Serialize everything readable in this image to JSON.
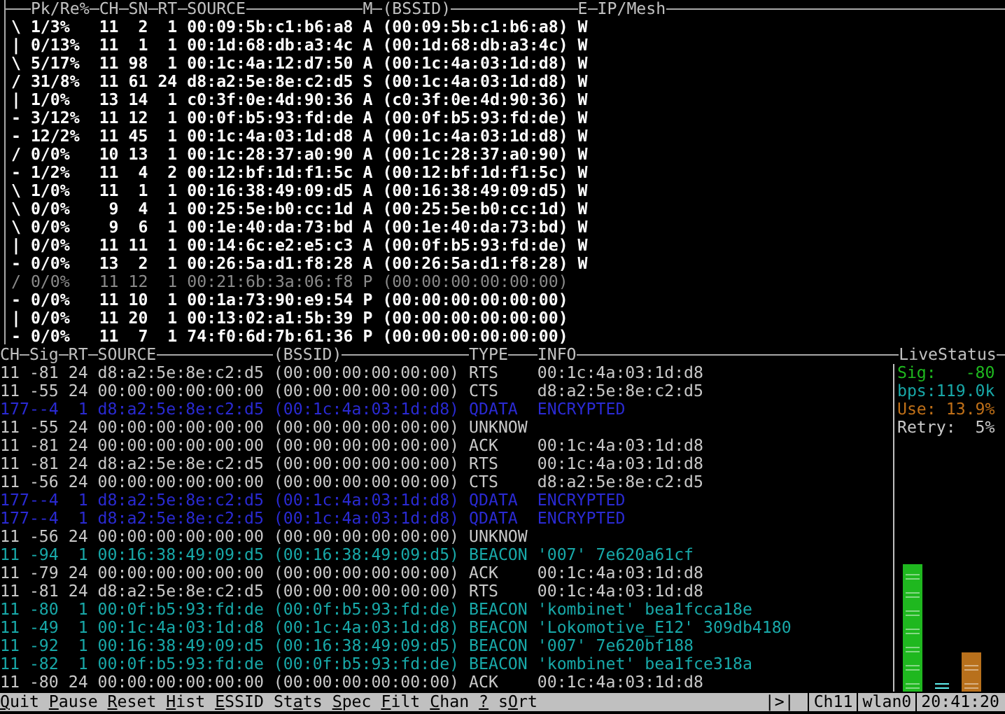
{
  "nodes_table": {
    "columns": [
      "Pk/Re%",
      "CH",
      "SN",
      "RT",
      "SOURCE",
      "M",
      "(BSSID)",
      "E",
      "IP/Mesh"
    ],
    "rows": [
      {
        "spinner": "\\",
        "pk_re": "1/3%",
        "ch": "11",
        "sn": "2",
        "rt": "1",
        "source": "00:09:5b:c1:b6:a8",
        "mode": "A",
        "bssid": "(00:09:5b:c1:b6:a8)",
        "enc": "W",
        "active": true
      },
      {
        "spinner": "|",
        "pk_re": "0/13%",
        "ch": "11",
        "sn": "1",
        "rt": "1",
        "source": "00:1d:68:db:a3:4c",
        "mode": "A",
        "bssid": "(00:1d:68:db:a3:4c)",
        "enc": "W",
        "active": true
      },
      {
        "spinner": "\\",
        "pk_re": "5/17%",
        "ch": "11",
        "sn": "98",
        "rt": "1",
        "source": "00:1c:4a:12:d7:50",
        "mode": "A",
        "bssid": "(00:1c:4a:03:1d:d8)",
        "enc": "W",
        "active": true
      },
      {
        "spinner": "/",
        "pk_re": "31/8%",
        "ch": "11",
        "sn": "61",
        "rt": "24",
        "source": "d8:a2:5e:8e:c2:d5",
        "mode": "S",
        "bssid": "(00:1c:4a:03:1d:d8)",
        "enc": "W",
        "active": true
      },
      {
        "spinner": "|",
        "pk_re": "1/0%",
        "ch": "13",
        "sn": "14",
        "rt": "1",
        "source": "c0:3f:0e:4d:90:36",
        "mode": "A",
        "bssid": "(c0:3f:0e:4d:90:36)",
        "enc": "W",
        "active": true
      },
      {
        "spinner": "-",
        "pk_re": "3/12%",
        "ch": "11",
        "sn": "12",
        "rt": "1",
        "source": "00:0f:b5:93:fd:de",
        "mode": "A",
        "bssid": "(00:0f:b5:93:fd:de)",
        "enc": "W",
        "active": true
      },
      {
        "spinner": "-",
        "pk_re": "12/2%",
        "ch": "11",
        "sn": "45",
        "rt": "1",
        "source": "00:1c:4a:03:1d:d8",
        "mode": "A",
        "bssid": "(00:1c:4a:03:1d:d8)",
        "enc": "W",
        "active": true
      },
      {
        "spinner": "/",
        "pk_re": "0/0%",
        "ch": "10",
        "sn": "13",
        "rt": "1",
        "source": "00:1c:28:37:a0:90",
        "mode": "A",
        "bssid": "(00:1c:28:37:a0:90)",
        "enc": "W",
        "active": true
      },
      {
        "spinner": "-",
        "pk_re": "1/2%",
        "ch": "11",
        "sn": "4",
        "rt": "2",
        "source": "00:12:bf:1d:f1:5c",
        "mode": "A",
        "bssid": "(00:12:bf:1d:f1:5c)",
        "enc": "W",
        "active": true
      },
      {
        "spinner": "\\",
        "pk_re": "1/0%",
        "ch": "11",
        "sn": "1",
        "rt": "1",
        "source": "00:16:38:49:09:d5",
        "mode": "A",
        "bssid": "(00:16:38:49:09:d5)",
        "enc": "W",
        "active": true
      },
      {
        "spinner": "\\",
        "pk_re": "0/0%",
        "ch": "9",
        "sn": "4",
        "rt": "1",
        "source": "00:25:5e:b0:cc:1d",
        "mode": "A",
        "bssid": "(00:25:5e:b0:cc:1d)",
        "enc": "W",
        "active": true
      },
      {
        "spinner": "\\",
        "pk_re": "0/0%",
        "ch": "9",
        "sn": "6",
        "rt": "1",
        "source": "00:1e:40:da:73:bd",
        "mode": "A",
        "bssid": "(00:1e:40:da:73:bd)",
        "enc": "W",
        "active": true
      },
      {
        "spinner": "|",
        "pk_re": "0/0%",
        "ch": "11",
        "sn": "11",
        "rt": "1",
        "source": "00:14:6c:e2:e5:c3",
        "mode": "A",
        "bssid": "(00:0f:b5:93:fd:de)",
        "enc": "W",
        "active": true
      },
      {
        "spinner": "-",
        "pk_re": "0/0%",
        "ch": "13",
        "sn": "2",
        "rt": "1",
        "source": "00:26:5a:d1:f8:28",
        "mode": "A",
        "bssid": "(00:26:5a:d1:f8:28)",
        "enc": "W",
        "active": true
      },
      {
        "spinner": "/",
        "pk_re": "0/0%",
        "ch": "11",
        "sn": "12",
        "rt": "1",
        "source": "00:21:6b:3a:06:f8",
        "mode": "P",
        "bssid": "(00:00:00:00:00:00)",
        "active": false
      },
      {
        "spinner": "-",
        "pk_re": "0/0%",
        "ch": "11",
        "sn": "10",
        "rt": "1",
        "source": "00:1a:73:90:e9:54",
        "mode": "P",
        "bssid": "(00:00:00:00:00:00)",
        "active": true
      },
      {
        "spinner": "|",
        "pk_re": "0/0%",
        "ch": "11",
        "sn": "20",
        "rt": "1",
        "source": "00:13:02:a1:5b:39",
        "mode": "P",
        "bssid": "(00:00:00:00:00:00)",
        "active": true
      },
      {
        "spinner": "-",
        "pk_re": "0/0%",
        "ch": "11",
        "sn": "7",
        "rt": "1",
        "source": "74:f0:6d:7b:61:36",
        "mode": "P",
        "bssid": "(00:00:00:00:00:00)",
        "active": true
      }
    ]
  },
  "packets_table": {
    "columns": [
      "CH",
      "Sig",
      "RT",
      "SOURCE",
      "(BSSID)",
      "TYPE",
      "INFO"
    ],
    "rows": [
      {
        "ch": "11",
        "sig": "-81",
        "rt": "24",
        "source": "d8:a2:5e:8e:c2:d5",
        "bssid": "(00:00:00:00:00:00)",
        "type": "RTS",
        "info": "00:1c:4a:03:1d:d8",
        "color": "#c8c8c8"
      },
      {
        "ch": "11",
        "sig": "-55",
        "rt": "24",
        "source": "00:00:00:00:00:00",
        "bssid": "(00:00:00:00:00:00)",
        "type": "CTS",
        "info": "d8:a2:5e:8e:c2:d5",
        "color": "#c8c8c8"
      },
      {
        "ch": "177",
        "sig": "--4",
        "rt": "1",
        "source": "d8:a2:5e:8e:c2:d5",
        "bssid": "(00:1c:4a:03:1d:d8)",
        "type": "QDATA",
        "info": "ENCRYPTED",
        "color": "#2a2ad2"
      },
      {
        "ch": "11",
        "sig": "-55",
        "rt": "24",
        "source": "00:00:00:00:00:00",
        "bssid": "(00:00:00:00:00:00)",
        "type": "UNKNOW",
        "color": "#c8c8c8"
      },
      {
        "ch": "11",
        "sig": "-81",
        "rt": "24",
        "source": "00:00:00:00:00:00",
        "bssid": "(00:00:00:00:00:00)",
        "type": "ACK",
        "info": "00:1c:4a:03:1d:d8",
        "color": "#c8c8c8"
      },
      {
        "ch": "11",
        "sig": "-81",
        "rt": "24",
        "source": "d8:a2:5e:8e:c2:d5",
        "bssid": "(00:00:00:00:00:00)",
        "type": "RTS",
        "info": "00:1c:4a:03:1d:d8",
        "color": "#c8c8c8"
      },
      {
        "ch": "11",
        "sig": "-56",
        "rt": "24",
        "source": "00:00:00:00:00:00",
        "bssid": "(00:00:00:00:00:00)",
        "type": "CTS",
        "info": "d8:a2:5e:8e:c2:d5",
        "color": "#c8c8c8"
      },
      {
        "ch": "177",
        "sig": "--4",
        "rt": "1",
        "source": "d8:a2:5e:8e:c2:d5",
        "bssid": "(00:1c:4a:03:1d:d8)",
        "type": "QDATA",
        "info": "ENCRYPTED",
        "color": "#2a2ad2"
      },
      {
        "ch": "177",
        "sig": "--4",
        "rt": "1",
        "source": "d8:a2:5e:8e:c2:d5",
        "bssid": "(00:1c:4a:03:1d:d8)",
        "type": "QDATA",
        "info": "ENCRYPTED",
        "color": "#2a2ad2"
      },
      {
        "ch": "11",
        "sig": "-56",
        "rt": "24",
        "source": "00:00:00:00:00:00",
        "bssid": "(00:00:00:00:00:00)",
        "type": "UNKNOW",
        "color": "#c8c8c8"
      },
      {
        "ch": "11",
        "sig": "-94",
        "rt": "1",
        "source": "00:16:38:49:09:d5",
        "bssid": "(00:16:38:49:09:d5)",
        "type": "BEACON",
        "info": "'007' 7e620a61cf",
        "color": "#18a8a8"
      },
      {
        "ch": "11",
        "sig": "-79",
        "rt": "24",
        "source": "00:00:00:00:00:00",
        "bssid": "(00:00:00:00:00:00)",
        "type": "ACK",
        "info": "00:1c:4a:03:1d:d8",
        "color": "#c8c8c8"
      },
      {
        "ch": "11",
        "sig": "-81",
        "rt": "24",
        "source": "d8:a2:5e:8e:c2:d5",
        "bssid": "(00:00:00:00:00:00)",
        "type": "RTS",
        "info": "00:1c:4a:03:1d:d8",
        "color": "#c8c8c8"
      },
      {
        "ch": "11",
        "sig": "-80",
        "rt": "1",
        "source": "00:0f:b5:93:fd:de",
        "bssid": "(00:0f:b5:93:fd:de)",
        "type": "BEACON",
        "info": "'kombinet' bea1fcca18e",
        "color": "#18a8a8"
      },
      {
        "ch": "11",
        "sig": "-49",
        "rt": "1",
        "source": "00:1c:4a:03:1d:d8",
        "bssid": "(00:1c:4a:03:1d:d8)",
        "type": "BEACON",
        "info": "'Lokomotive_E12' 309db4180",
        "color": "#18a8a8"
      },
      {
        "ch": "11",
        "sig": "-92",
        "rt": "1",
        "source": "00:16:38:49:09:d5",
        "bssid": "(00:16:38:49:09:d5)",
        "type": "BEACON",
        "info": "'007' 7e620bf188",
        "color": "#18a8a8"
      },
      {
        "ch": "11",
        "sig": "-82",
        "rt": "1",
        "source": "00:0f:b5:93:fd:de",
        "bssid": "(00:0f:b5:93:fd:de)",
        "type": "BEACON",
        "info": "'kombinet' bea1fce318a",
        "color": "#18a8a8"
      },
      {
        "ch": "11",
        "sig": "-80",
        "rt": "24",
        "source": "00:00:00:00:00:00",
        "bssid": "(00:00:00:00:00:00)",
        "type": "ACK",
        "info": "00:1c:4a:03:1d:d8",
        "color": "#c8c8c8"
      }
    ]
  },
  "live_status": {
    "title": "LiveStatus",
    "items": [
      {
        "label": "Sig:",
        "value": "-80",
        "color": "#1fb81f"
      },
      {
        "label": "bps:",
        "value": "119.0k",
        "color": "#18a8a8"
      },
      {
        "label": "Use:",
        "value": "13.9%",
        "color": "#c07018"
      },
      {
        "label": "Retry:",
        "value": "5%",
        "color": "#c8c8c8"
      }
    ],
    "bars": [
      {
        "kind": "solid",
        "level": 0.39,
        "color": "#1fb81f"
      },
      {
        "kind": "marks",
        "level": 0.03,
        "color": "#5ff0f0"
      },
      {
        "kind": "solid",
        "level": 0.12,
        "color": "#b8701c"
      }
    ]
  },
  "menu": [
    {
      "key": "Q",
      "after": "uit"
    },
    {
      "key": "P",
      "after": "ause"
    },
    {
      "key": "R",
      "after": "eset"
    },
    {
      "key": "H",
      "after": "ist"
    },
    {
      "key": "E",
      "after": "SSID"
    },
    {
      "before": "St",
      "key": "a",
      "after": "ts"
    },
    {
      "key": "S",
      "after": "pec"
    },
    {
      "key": "F",
      "after": "ilt"
    },
    {
      "key": "C",
      "after": "han"
    },
    {
      "key": "?"
    },
    {
      "before": "s",
      "key": "O",
      "after": "rt"
    }
  ],
  "status_bar": {
    "play_state": "|>|",
    "channel": "Ch11",
    "interface": "wlan0",
    "time": "20:41:20"
  }
}
